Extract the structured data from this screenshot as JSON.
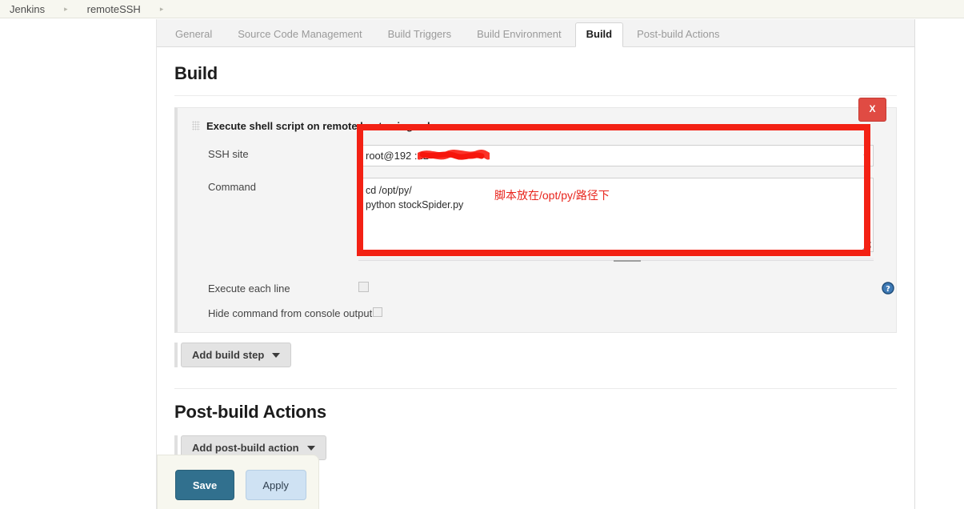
{
  "breadcrumb": {
    "items": [
      {
        "label": "Jenkins"
      },
      {
        "label": "remoteSSH"
      }
    ],
    "separator": "▸"
  },
  "tabs": [
    {
      "label": "General",
      "active": false
    },
    {
      "label": "Source Code Management",
      "active": false
    },
    {
      "label": "Build Triggers",
      "active": false
    },
    {
      "label": "Build Environment",
      "active": false
    },
    {
      "label": "Build",
      "active": true
    },
    {
      "label": "Post-build Actions",
      "active": false
    }
  ],
  "build_section": {
    "title": "Build",
    "step": {
      "title": "Execute shell script on remote host using ssh",
      "delete_label": "X",
      "fields": {
        "ssh_site": {
          "label": "SSH site",
          "value": "root@192             :22",
          "value_prefix": "root@192",
          "value_suffix": ":22",
          "redacted": true,
          "caret": "▾"
        },
        "command": {
          "label": "Command",
          "value": "cd /opt/py/\npython stockSpider.py",
          "annotation": "脚本放在/opt/py/路径下"
        },
        "execute_each_line": {
          "label": "Execute each line",
          "checked": false
        },
        "hide_command": {
          "label": "Hide command from console output",
          "checked": false
        }
      },
      "help_icon": "help-icon"
    },
    "add_build_step_label": "Add build step"
  },
  "postbuild_section": {
    "title": "Post-build Actions",
    "add_post_build_action_label": "Add post-build action"
  },
  "footer": {
    "save_label": "Save",
    "apply_label": "Apply"
  },
  "colors": {
    "annotation_red": "#f32114",
    "delete_red": "#e04b43",
    "save_teal": "#31708e",
    "apply_blue": "#cfe2f3",
    "help_blue": "#2b6cb0"
  }
}
